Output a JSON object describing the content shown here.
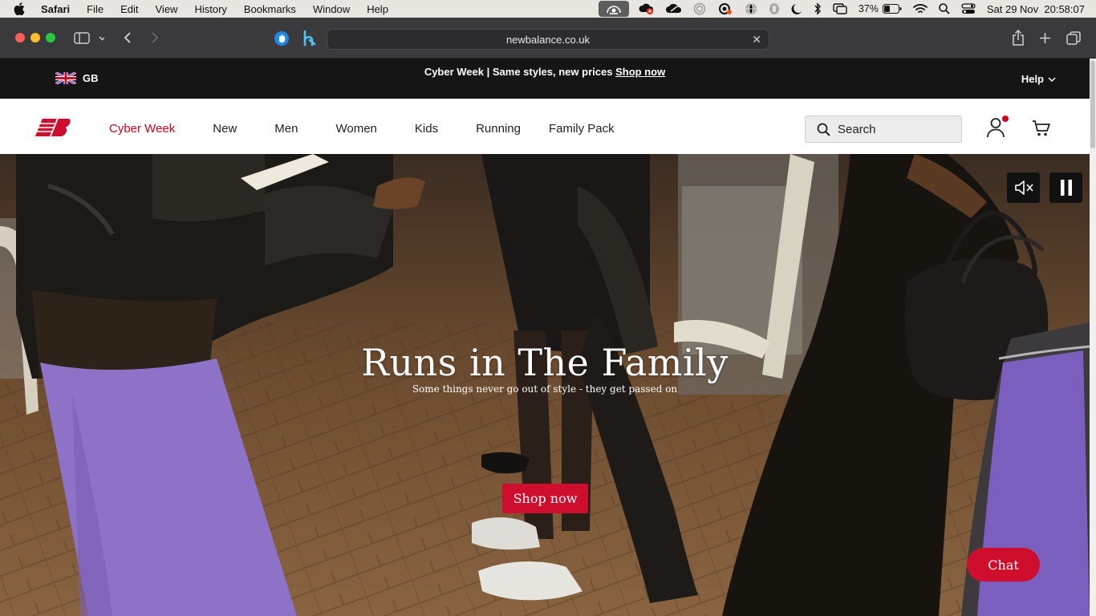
{
  "menubar": {
    "app": "Safari",
    "items": [
      "File",
      "Edit",
      "View",
      "History",
      "Bookmarks",
      "Window",
      "Help"
    ],
    "battery": "37%",
    "datetime": "Sat 29 Nov  20:58:07"
  },
  "browser": {
    "url": "newbalance.co.uk"
  },
  "promo": {
    "region": "GB",
    "message": "Cyber Week | Same styles, new prices",
    "link": "Shop now",
    "help": "Help"
  },
  "nav": {
    "items": [
      {
        "label": "Cyber Week",
        "color": "#d2001e"
      },
      {
        "label": "New"
      },
      {
        "label": "Men"
      },
      {
        "label": "Women"
      },
      {
        "label": "Kids"
      },
      {
        "label": "Running"
      },
      {
        "label": "Family Pack"
      }
    ],
    "search_label": "Search"
  },
  "hero": {
    "title": "Runs in The Family",
    "subtitle": "Some things never go out of style - they get passed on",
    "cta": "Shop now",
    "chat": "Chat"
  },
  "colors": {
    "brand_red": "#cf0d2c",
    "promo_bg": "#151515"
  }
}
